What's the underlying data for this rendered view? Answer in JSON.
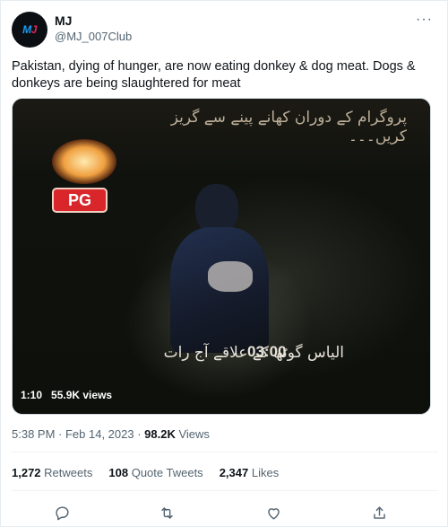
{
  "author": {
    "name": "MJ",
    "handle": "@MJ_007Club",
    "avatar_text": "MJ"
  },
  "more_icon": "more-horizontal-icon",
  "tweet": {
    "text": "Pakistan, dying of hunger, are now eating donkey & dog meat. Dogs & donkeys are being slaughtered for meat"
  },
  "media": {
    "overlay_urdu_top": "پروگرام کے دوران کھانے پینے سے گریز کریں۔۔۔",
    "badge": "PG",
    "overlay_urdu_bottom": "الیاس گوٹھ کے علاقے آج رات",
    "overlay_time": "03:00",
    "duration": "1:10",
    "views": "55.9K views"
  },
  "timestamp": {
    "text": "5:38 PM · Feb 14, 2023 · ",
    "views_count": "98.2K",
    "views_label": " Views"
  },
  "stats": {
    "retweets_count": "1,272",
    "retweets_label": "Retweets",
    "quotes_count": "108",
    "quotes_label": "Quote Tweets",
    "likes_count": "2,347",
    "likes_label": "Likes"
  },
  "actions": [
    "reply-icon",
    "retweet-icon",
    "like-icon",
    "share-icon"
  ],
  "colors": {
    "text_primary": "#0f1419",
    "text_secondary": "#536471",
    "divider": "#eff3f4",
    "badge_red": "#d8262b"
  }
}
